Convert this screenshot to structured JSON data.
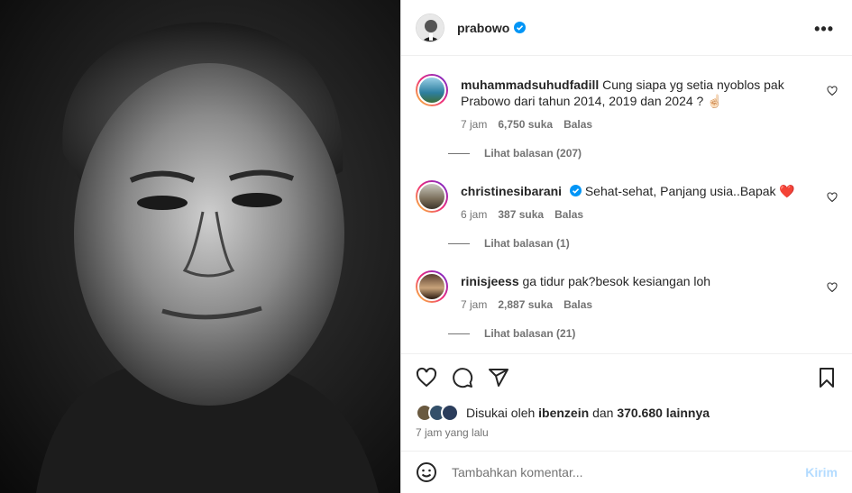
{
  "post": {
    "username": "prabowo",
    "more_label": "•••"
  },
  "comments": [
    {
      "username": "muhammadsuhudfadill",
      "text": "Cung siapa yg setia nyoblos pak Prabowo dari tahun 2014, 2019 dan 2024 ? ☝🏻",
      "time": "7 jam",
      "likes": "6,750 suka",
      "reply": "Balas",
      "view_replies": "Lihat balasan (207)"
    },
    {
      "username": "christinesibarani",
      "text": "Sehat-sehat, Panjang usia..Bapak ❤️",
      "time": "6 jam",
      "likes": "387 suka",
      "reply": "Balas",
      "view_replies": "Lihat balasan (1)"
    },
    {
      "username": "rinisjeess",
      "text": "ga tidur pak?besok kesiangan loh",
      "time": "7 jam",
      "likes": "2,887 suka",
      "reply": "Balas",
      "view_replies": "Lihat balasan (21)"
    }
  ],
  "likes": {
    "prefix": "Disukai oleh",
    "user": "ibenzein",
    "middle": "dan",
    "count": "370.680 lainnya"
  },
  "timestamp": "7 jam yang lalu",
  "add_comment": {
    "placeholder": "Tambahkan komentar...",
    "post_label": "Kirim"
  },
  "colors": {
    "verified": "#0095f6",
    "heart_red": "#ed4956",
    "post_disabled": "#b3dbff"
  }
}
